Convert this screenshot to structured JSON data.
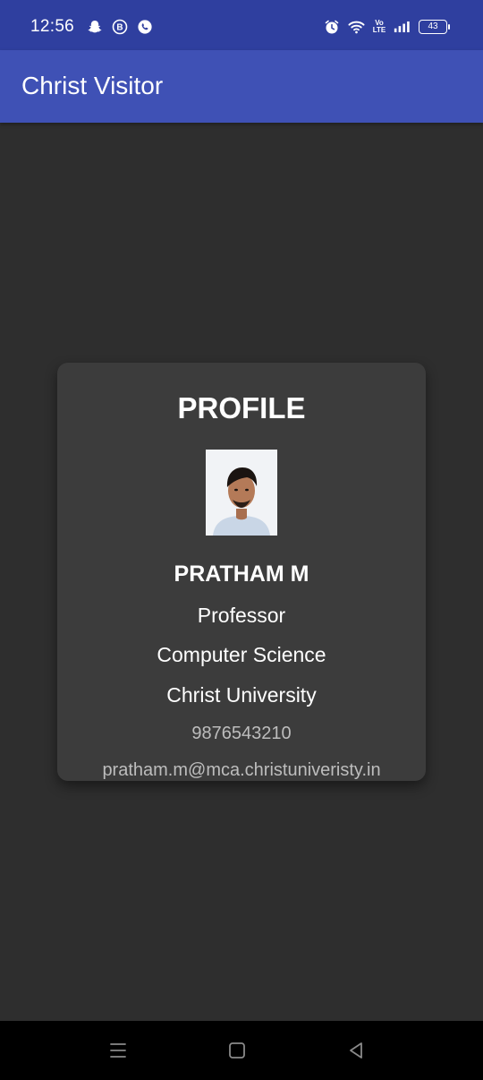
{
  "status_bar": {
    "time": "12:56",
    "left_icons": [
      "snapchat-icon",
      "b-badge-icon",
      "whatsapp-business-icon"
    ],
    "right_icons": [
      "alarm-icon",
      "wifi-icon",
      "volte-icon",
      "signal-icon",
      "battery-icon"
    ],
    "volte_label": "Vo LTE",
    "battery_level": "43",
    "bar_color": "#2f3f9f"
  },
  "app_bar": {
    "title": "Christ Visitor",
    "color": "#3f51b5"
  },
  "profile_card": {
    "heading": "PROFILE",
    "photo_icon": "profile-photo",
    "name": "PRATHAM M",
    "designation": "Professor",
    "department": "Computer Science",
    "university": "Christ University",
    "phone": "9876543210",
    "email": "pratham.m@mca.christuniveristy.in",
    "background": "#3c3c3c"
  },
  "nav_bar": {
    "buttons": [
      "menu-icon",
      "home-icon",
      "back-icon"
    ]
  },
  "colors": {
    "page_background": "#2e2e2e",
    "primary_text": "#ffffff",
    "secondary_text": "#bdbdbd"
  }
}
